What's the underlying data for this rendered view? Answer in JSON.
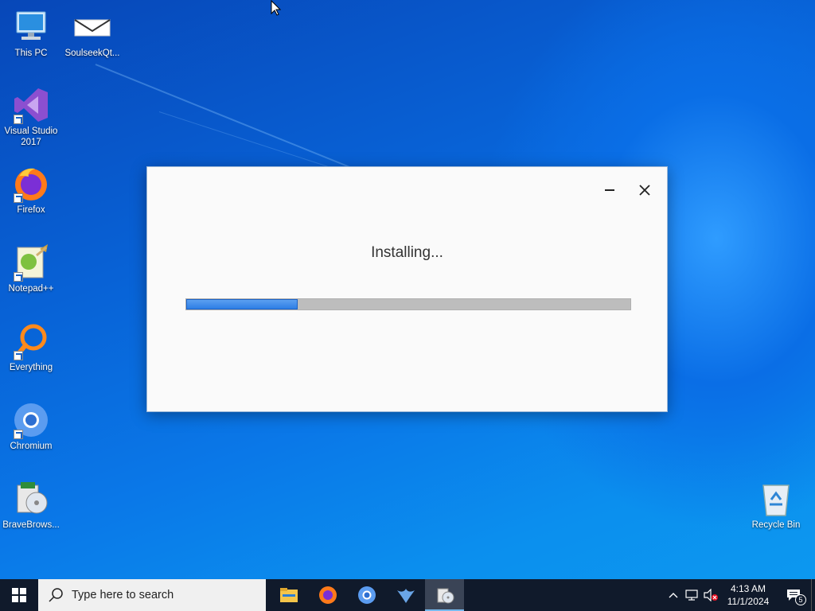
{
  "desktop": {
    "icons": [
      {
        "label": "This PC"
      },
      {
        "label": "SoulseekQt..."
      },
      {
        "label": "Visual Studio 2017"
      },
      {
        "label": "Firefox"
      },
      {
        "label": "Notepad++"
      },
      {
        "label": "Everything"
      },
      {
        "label": "Chromium"
      },
      {
        "label": "BraveBrows..."
      },
      {
        "label": "Recycle Bin"
      }
    ]
  },
  "dialog": {
    "status_text": "Installing...",
    "progress_fraction": 0.25
  },
  "taskbar": {
    "search_placeholder": "Type here to search",
    "apps": [
      "file-explorer-icon",
      "firefox-icon",
      "chromium-icon",
      "soulseek-icon",
      "installer-icon"
    ],
    "clock_time": "4:13 AM",
    "clock_date": "11/1/2024",
    "notification_count": "5"
  }
}
